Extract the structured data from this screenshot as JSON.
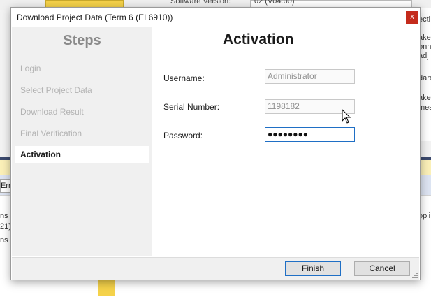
{
  "background_app": {
    "top_label": "Software Version:",
    "top_combo_value": "02 (V04.00)",
    "right_fragments": [
      "ecti",
      "ake",
      "onne",
      "adj",
      "dard",
      "ake",
      "mes"
    ],
    "error_tab": "Err",
    "left_fragments": [
      "ns |",
      "21).",
      "ns |"
    ],
    "right_lower_fragment": "opli"
  },
  "dialog": {
    "title": "Download Project Data (Term 6 (EL6910))",
    "close_glyph": "x",
    "steps_heading": "Steps",
    "steps": [
      {
        "label": "Login",
        "active": false
      },
      {
        "label": "Select Project Data",
        "active": false
      },
      {
        "label": "Download Result",
        "active": false
      },
      {
        "label": "Final Verification",
        "active": false
      },
      {
        "label": "Activation",
        "active": true
      }
    ],
    "content_title": "Activation",
    "fields": {
      "username": {
        "label": "Username:",
        "value": "Administrator"
      },
      "serial": {
        "label": "Serial Number:",
        "value": "1198182"
      },
      "password": {
        "label": "Password:",
        "value": "●●●●●●●●"
      }
    },
    "buttons": {
      "finish": "Finish",
      "cancel": "Cancel"
    }
  },
  "colors": {
    "close_button": "#c42b1c",
    "focus_border": "#1f6fc5",
    "steps_panel": "#f0f0f0"
  }
}
